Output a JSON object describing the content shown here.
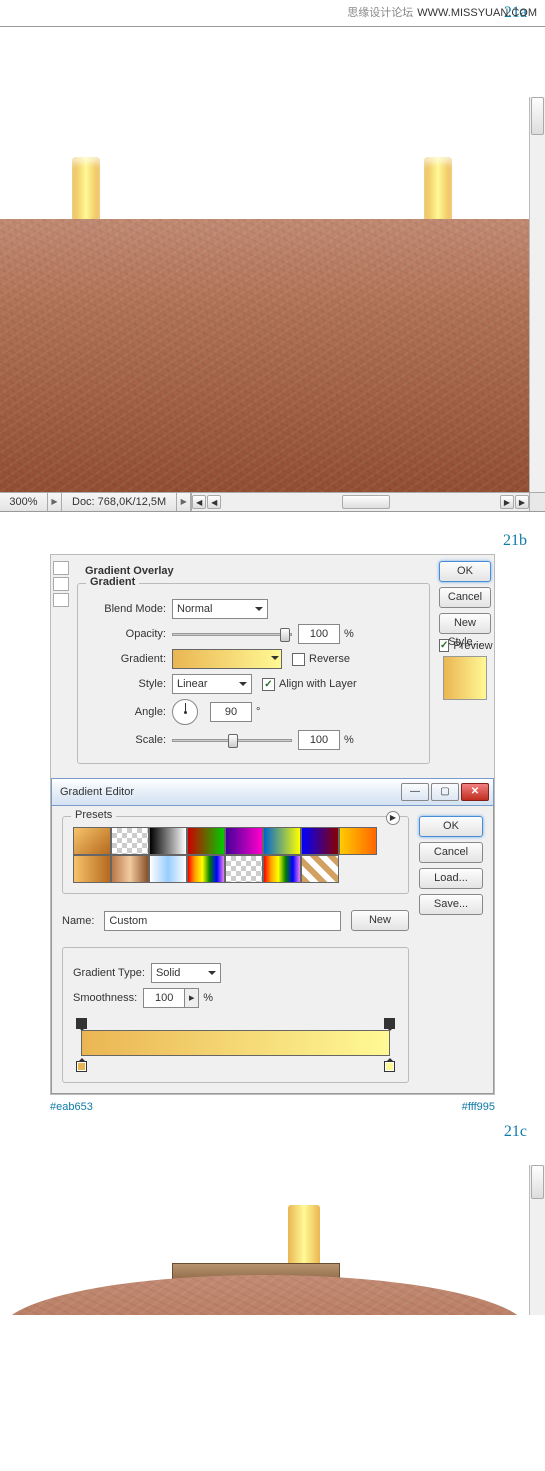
{
  "watermark": {
    "cn": "思缘设计论坛",
    "en": "WWW.MISSYUAN.COM"
  },
  "steps": {
    "a": "21a",
    "b": "21b",
    "c": "21c"
  },
  "statusbar": {
    "zoom": "300%",
    "doc": "Doc: 768,0K/12,5M"
  },
  "layer_style": {
    "section_title": "Gradient Overlay",
    "group_title": "Gradient",
    "labels": {
      "blend_mode": "Blend Mode:",
      "opacity": "Opacity:",
      "gradient": "Gradient:",
      "reverse": "Reverse",
      "style": "Style:",
      "align": "Align with Layer",
      "angle": "Angle:",
      "scale": "Scale:"
    },
    "blend_mode": "Normal",
    "opacity": "100",
    "style": "Linear",
    "angle": "90",
    "scale": "100",
    "side_buttons": {
      "ok": "OK",
      "cancel": "Cancel",
      "new_style": "New Style...",
      "preview": "Preview"
    }
  },
  "gradient_editor": {
    "title": "Gradient Editor",
    "presets_label": "Presets",
    "buttons": {
      "ok": "OK",
      "cancel": "Cancel",
      "load": "Load...",
      "save": "Save...",
      "new": "New"
    },
    "name_label": "Name:",
    "name_value": "Custom",
    "type_label": "Gradient Type:",
    "type_value": "Solid",
    "smoothness_label": "Smoothness:",
    "smoothness_value": "100",
    "swatches": [
      "linear-gradient(135deg,#f7c36a,#b56a1e)",
      "repeating-conic-gradient(#ccc 0 25%,#fff 0 50%) 0 0/10px 10px",
      "linear-gradient(90deg,#000,#fff)",
      "linear-gradient(90deg,#c00,#0c0)",
      "linear-gradient(90deg,#409,#f0c)",
      "linear-gradient(90deg,#06c,#ff0)",
      "linear-gradient(90deg,#00f,#800)",
      "linear-gradient(90deg,#fc0,#f60)",
      "linear-gradient(90deg,#f7c36a,#b56a1e)",
      "linear-gradient(90deg,#b87848,#f2cba0,#8a5028)",
      "linear-gradient(90deg,#fff,#9cf,#fff)",
      "linear-gradient(90deg,red,orange,yellow,green,blue,violet)",
      "repeating-conic-gradient(#ccc 0 25%,#fff 0 50%) 0 0/10px 10px",
      "linear-gradient(90deg,red,orange,yellow,green,blue,violet)",
      "repeating-linear-gradient(45deg,#d2a060 0 6px,#fff 6px 12px)"
    ]
  },
  "colors": {
    "left": "#eab653",
    "right": "#fff995"
  },
  "pct": "%",
  "deg": "°"
}
